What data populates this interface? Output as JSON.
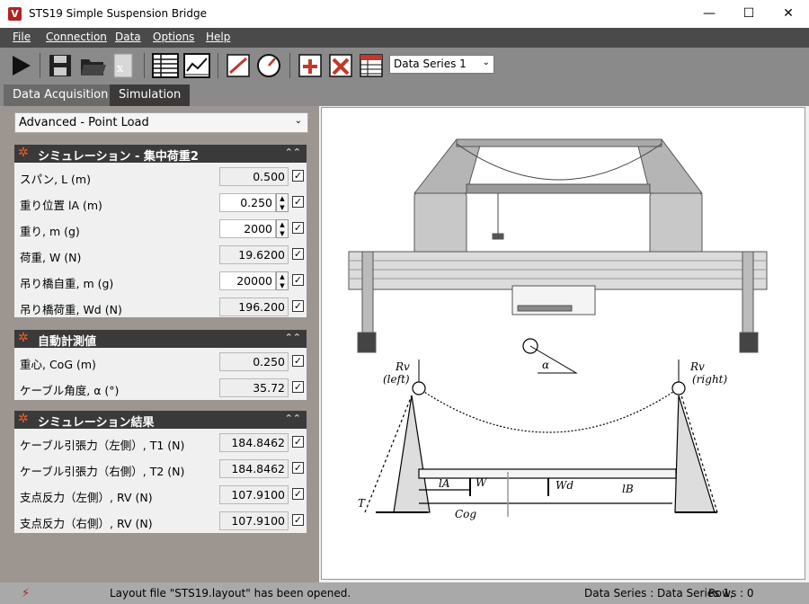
{
  "window": {
    "title": "STS19 Simple Suspension Bridge",
    "minimize": "—",
    "maximize": "☐",
    "close": "✕"
  },
  "menu": {
    "file": "File",
    "connection": "Connection",
    "data": "Data",
    "options": "Options",
    "help": "Help"
  },
  "toolbar": {
    "data_series": "Data Series 1"
  },
  "tabs": {
    "data_acquisition": "Data Acquisition",
    "simulation": "Simulation"
  },
  "mode": "Advanced - Point Load",
  "sections": {
    "sim": {
      "title": "シミュレーション - 集中荷重2",
      "rows": [
        {
          "label": "スパン, L (m)",
          "value": "0.500"
        },
        {
          "label": "重り位置 lA (m)",
          "value": "0.250"
        },
        {
          "label": "重り, m (g)",
          "value": "2000"
        },
        {
          "label": "荷重, W (N)",
          "value": "19.6200"
        },
        {
          "label": "吊り橋自重, m (g)",
          "value": "20000"
        },
        {
          "label": "吊り橋荷重, Wd (N)",
          "value": "196.200"
        }
      ]
    },
    "auto": {
      "title": "自動計測値",
      "rows": [
        {
          "label": "重心, CoG (m)",
          "value": "0.250"
        },
        {
          "label": "ケーブル角度, α (°)",
          "value": "35.72"
        }
      ]
    },
    "results": {
      "title": "シミュレーション結果",
      "rows": [
        {
          "label": "ケーブル引張力（左側）, T1 (N)",
          "value": "184.8462"
        },
        {
          "label": "ケーブル引張力（右側）, T2 (N)",
          "value": "184.8462"
        },
        {
          "label": "支点反力（左側）, RV (N)",
          "value": "107.9100"
        },
        {
          "label": "支点反力（右側）, RV (N)",
          "value": "107.9100"
        }
      ]
    }
  },
  "diagram": {
    "rv_left": "Rv",
    "left": "(left)",
    "rv_right": "Rv",
    "right": "(right)",
    "alpha": "α",
    "w": "W",
    "wd": "Wd",
    "la": "lA",
    "lb": "lB",
    "cog": "Cog",
    "t": "T"
  },
  "status": {
    "message": "Layout file \"STS19.layout\" has been opened.",
    "series": "Data Series : Data Series 1,",
    "rows": "Rows : 0"
  }
}
